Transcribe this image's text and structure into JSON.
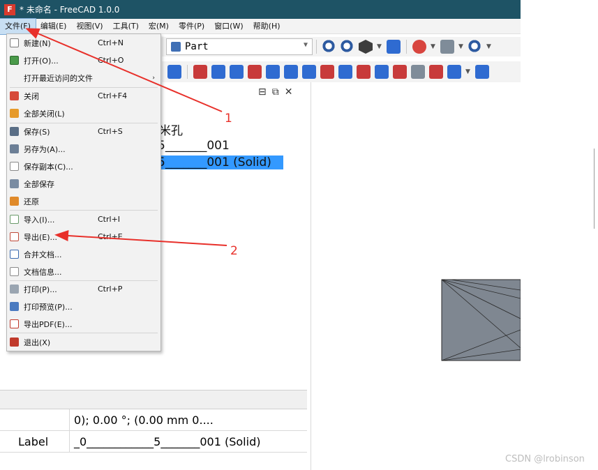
{
  "window": {
    "title": "* 未命名 - FreeCAD 1.0.0",
    "app_icon_letter": "F"
  },
  "menubar": {
    "items": [
      "文件(F)",
      "编辑(E)",
      "视图(V)",
      "工具(T)",
      "宏(M)",
      "零件(P)",
      "窗口(W)",
      "帮助(H)"
    ],
    "active": "文件(F)"
  },
  "workbench_selector": {
    "value": "Part"
  },
  "file_menu": {
    "items": [
      {
        "label": "新建(N)",
        "shortcut": "Ctrl+N",
        "icon": "new-document-icon"
      },
      {
        "label": "打开(O)...",
        "shortcut": "Ctrl+O",
        "icon": "open-icon"
      },
      {
        "label": "打开最近访问的文件",
        "shortcut": "",
        "icon": "",
        "submenu": "›"
      },
      {
        "label": "关闭",
        "shortcut": "Ctrl+F4",
        "icon": "close-icon"
      },
      {
        "label": "全部关闭(L)",
        "shortcut": "",
        "icon": "close-all-icon"
      },
      {
        "label": "保存(S)",
        "shortcut": "Ctrl+S",
        "icon": "save-icon"
      },
      {
        "label": "另存为(A)...",
        "shortcut": "",
        "icon": "save-as-icon"
      },
      {
        "label": "保存副本(C)...",
        "shortcut": "",
        "icon": "save-copy-icon"
      },
      {
        "label": "全部保存",
        "shortcut": "",
        "icon": "save-all-icon"
      },
      {
        "label": "还原",
        "shortcut": "",
        "icon": "revert-icon"
      },
      {
        "label": "导入(I)...",
        "shortcut": "Ctrl+I",
        "icon": "import-icon"
      },
      {
        "label": "导出(E)...",
        "shortcut": "Ctrl+E",
        "icon": "export-icon"
      },
      {
        "label": "合并文档...",
        "shortcut": "",
        "icon": "merge-icon"
      },
      {
        "label": "文档信息...",
        "shortcut": "",
        "icon": "document-info-icon"
      },
      {
        "label": "打印(P)...",
        "shortcut": "Ctrl+P",
        "icon": "print-icon"
      },
      {
        "label": "打印预览(P)...",
        "shortcut": "",
        "icon": "print-preview-icon"
      },
      {
        "label": "导出PDF(E)...",
        "shortcut": "",
        "icon": "pdf-icon"
      },
      {
        "label": "退出(X)",
        "shortcut": "",
        "icon": "exit-icon"
      }
    ]
  },
  "model_tree": {
    "rows": [
      "米孔",
      "5_______001",
      "5_______001 (Solid)"
    ],
    "selected_index": 2
  },
  "property_view": {
    "rows": [
      {
        "key": "",
        "value": "0); 0.00 °; (0.00 mm  0...."
      },
      {
        "key": "Label",
        "value": "_0____________5_______001 (Solid)"
      }
    ]
  },
  "annotations": {
    "labels": [
      "1",
      "2"
    ],
    "color": "#e8302a"
  },
  "watermark": "CSDN @lrobinson"
}
